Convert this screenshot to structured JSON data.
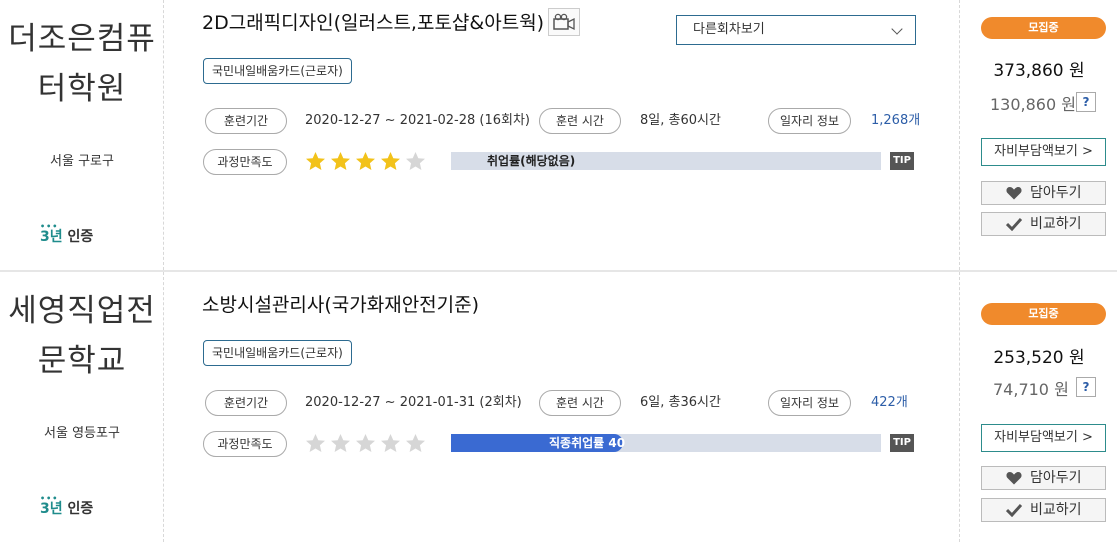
{
  "courses": [
    {
      "institution": {
        "name_line1": "더조은컴퓨",
        "name_line2": "터학원",
        "location": "서울 구로구",
        "cert_years": "3년",
        "cert_label": "인증"
      },
      "title": "2D그래픽디자인(일러스트,포토샵&아트웍)",
      "session_select": "다른회차보기",
      "card_badge": "국민내일배움카드(근로자)",
      "period_label": "훈련기간",
      "period_value": "2020-12-27 ~ 2021-02-28 (16회차)",
      "hours_label": "훈련 시간",
      "hours_value": "8일, 총60시간",
      "job_label": "일자리 정보",
      "job_value": "1,268개",
      "satisfaction_label": "과정만족도",
      "rating": 4,
      "rating_max": 5,
      "employment_label": "취업률(해당없음)",
      "employment_rate": 0,
      "tip": "TIP",
      "status": "모집중",
      "price": "373,860 원",
      "self_pay": "130,860 원",
      "help": "?",
      "self_pay_button": "자비부담액보기 >",
      "save_button": "담아두기",
      "compare_button": "비교하기"
    },
    {
      "institution": {
        "name_line1": "세영직업전",
        "name_line2": "문학교",
        "location": "서울 영등포구",
        "cert_years": "3년",
        "cert_label": "인증"
      },
      "title": "소방시설관리사(국가화재안전기준)",
      "card_badge": "국민내일배움카드(근로자)",
      "period_label": "훈련기간",
      "period_value": "2020-12-27 ~ 2021-01-31 (2회차)",
      "hours_label": "훈련 시간",
      "hours_value": "6일, 총36시간",
      "job_label": "일자리 정보",
      "job_value": "422개",
      "satisfaction_label": "과정만족도",
      "rating": 0,
      "rating_max": 5,
      "employment_label": "직종취업률 40",
      "employment_rate": 40,
      "tip": "TIP",
      "status": "모집중",
      "price": "253,520 원",
      "self_pay": "74,710 원",
      "help": "?",
      "self_pay_button": "자비부담액보기 >",
      "save_button": "담아두기",
      "compare_button": "비교하기"
    }
  ],
  "colors": {
    "accent": "#2d6b90",
    "status": "#f08a2c",
    "star_on": "#f2c21a",
    "star_off": "#d6d6d6",
    "bar_fill": "#3a6ad2",
    "bar_track": "#d7dde8",
    "cert": "#1f8c8c",
    "link": "#2d5ea8"
  },
  "icons": {
    "video": "video-camera-icon",
    "dropdown": "chevron-down-icon",
    "save": "heart-icon",
    "compare": "check-icon",
    "star": "star-icon"
  }
}
